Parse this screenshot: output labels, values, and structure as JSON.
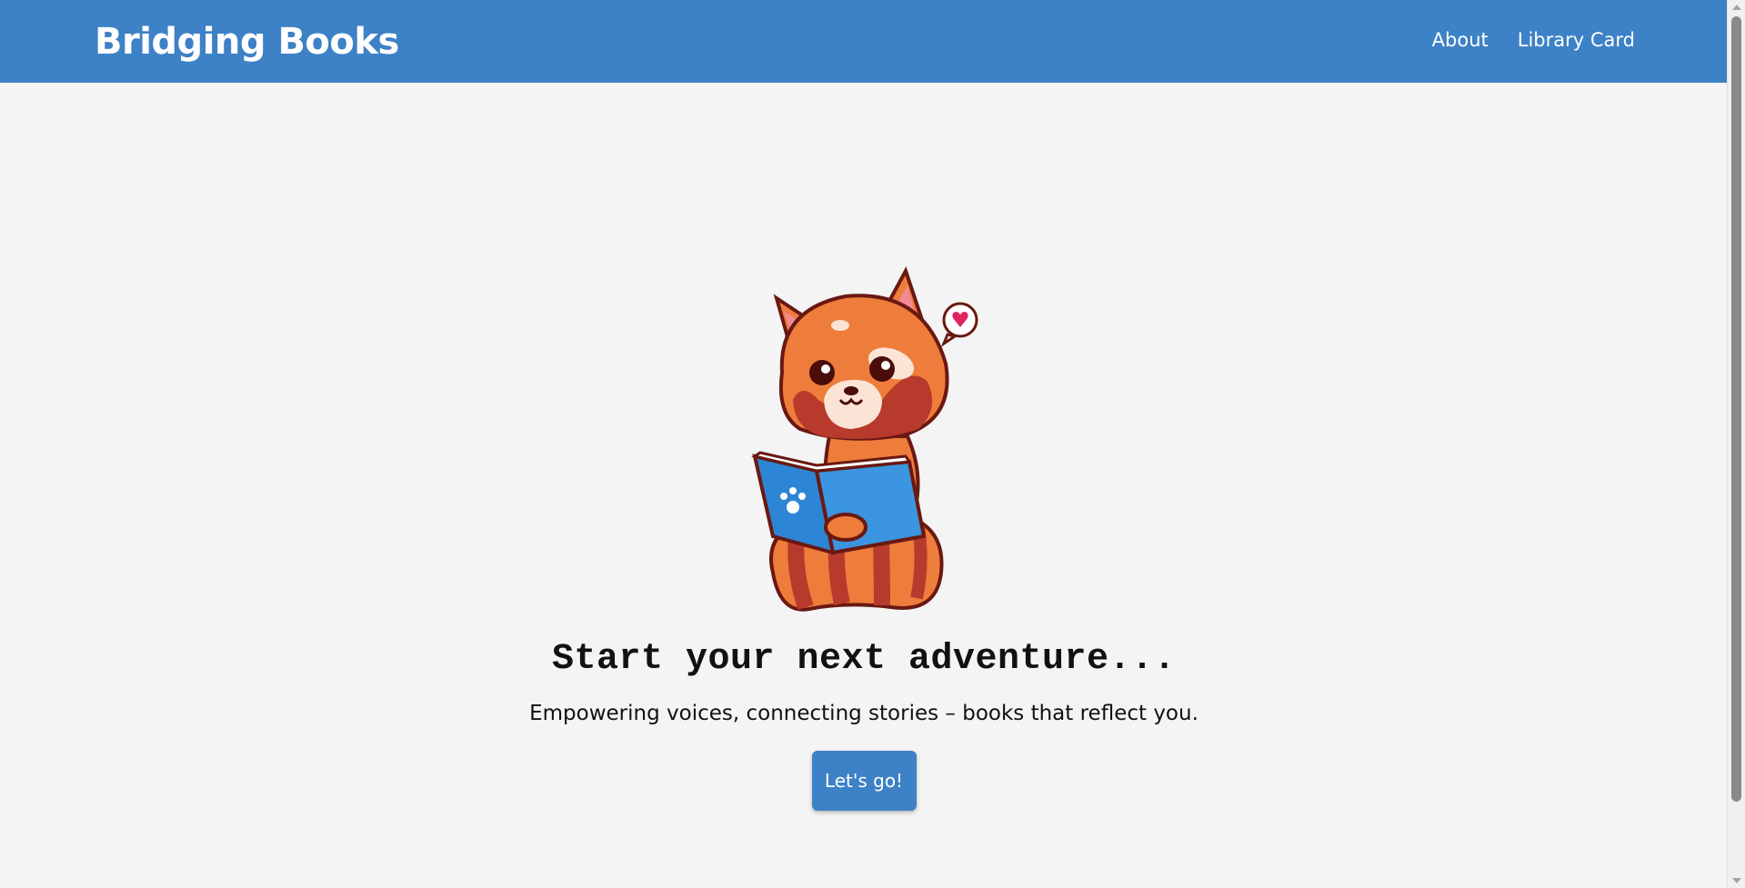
{
  "navbar": {
    "brand": "Bridging Books",
    "links": [
      {
        "label": "About"
      },
      {
        "label": "Library Card"
      }
    ]
  },
  "hero": {
    "mascot_icon": "red-panda-reading-book-icon",
    "headline": "Start your next adventure...",
    "tagline": "Empowering voices, connecting stories – books that reflect you.",
    "cta_label": "Let's go!"
  },
  "colors": {
    "primary": "#3d81c6",
    "background": "#f4f4f4",
    "text": "#111111"
  }
}
